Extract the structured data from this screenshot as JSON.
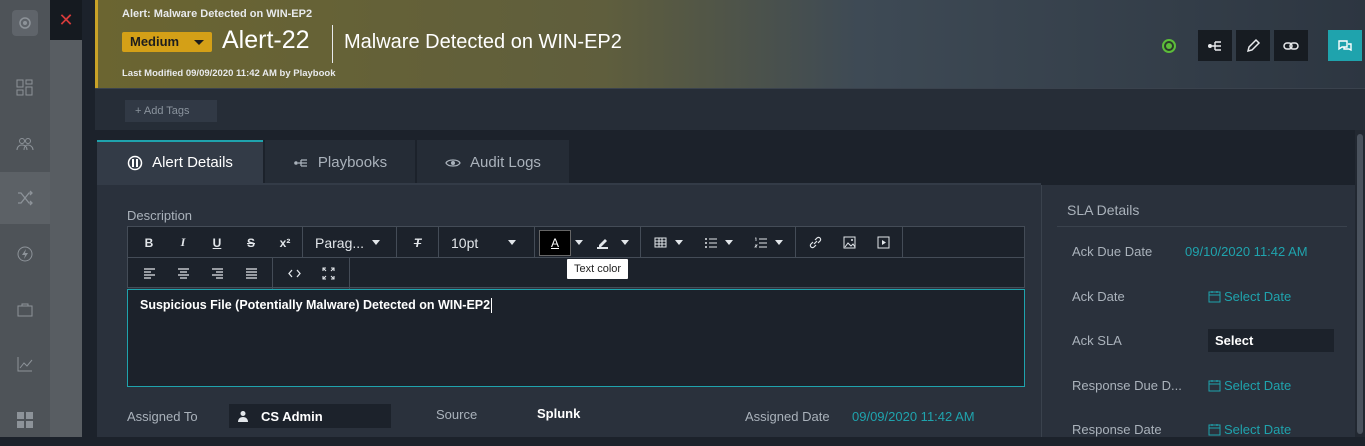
{
  "header": {
    "breadcrumb": "Alert: Malware Detected on WIN-EP2",
    "severity": "Medium",
    "alert_id": "Alert-22",
    "title": "Malware Detected on WIN-EP2",
    "last_modified": "Last Modified 09/09/2020 11:42 AM by Playbook"
  },
  "tags": {
    "add_label": "+ Add Tags"
  },
  "tabs": [
    {
      "label": "Alert Details"
    },
    {
      "label": "Playbooks"
    },
    {
      "label": "Audit Logs"
    }
  ],
  "description": {
    "label": "Description",
    "paragraph_select": "Parag...",
    "font_size": "10pt",
    "tooltip": "Text color",
    "content": "Suspicious File (Potentially Malware) Detected on WIN-EP2"
  },
  "fields": {
    "assigned_to_label": "Assigned To",
    "assigned_to_value": "CS Admin",
    "source_label": "Source",
    "source_value": "Splunk",
    "assigned_date_label": "Assigned Date",
    "assigned_date_value": "09/09/2020 11:42 AM"
  },
  "sla": {
    "title": "SLA Details",
    "ack_due_label": "Ack Due Date",
    "ack_due_value": "09/10/2020 11:42 AM",
    "ack_date_label": "Ack Date",
    "ack_date_value": "Select Date",
    "ack_sla_label": "Ack SLA",
    "ack_sla_value": "Select",
    "response_due_label": "Response Due D...",
    "response_due_value": "Select Date",
    "response_date_label": "Response Date",
    "response_date_value": "Select Date"
  },
  "colors": {
    "accent": "#1fa3ad",
    "severity": "#d4a017",
    "close": "#d63b3b"
  }
}
